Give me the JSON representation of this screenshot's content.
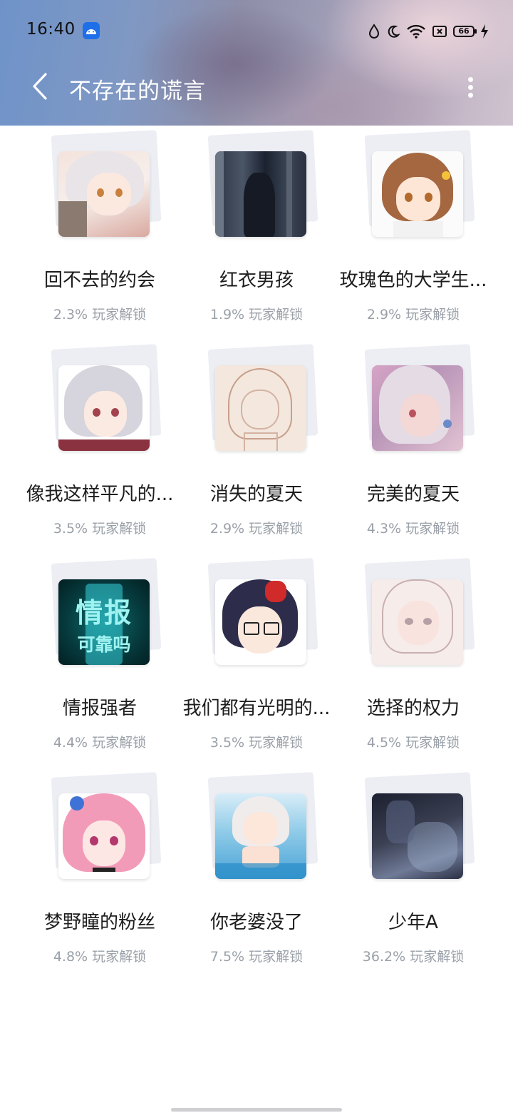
{
  "status_bar": {
    "time": "16:40",
    "battery": "66"
  },
  "header": {
    "title": "不存在的谎言"
  },
  "achievements": [
    {
      "title": "回不去的约会",
      "unlock": "2.3% 玩家解锁"
    },
    {
      "title": "红衣男孩",
      "unlock": "1.9% 玩家解锁"
    },
    {
      "title": "玫瑰色的大学生...",
      "unlock": "2.9% 玩家解锁"
    },
    {
      "title": "像我这样平凡的...",
      "unlock": "3.5% 玩家解锁"
    },
    {
      "title": "消失的夏天",
      "unlock": "2.9% 玩家解锁"
    },
    {
      "title": "完美的夏天",
      "unlock": "4.3% 玩家解锁"
    },
    {
      "title": "情报强者",
      "unlock": "4.4% 玩家解锁",
      "cover_text_1": "情报",
      "cover_text_2": "可靠吗"
    },
    {
      "title": "我们都有光明的...",
      "unlock": "3.5% 玩家解锁"
    },
    {
      "title": "选择的权力",
      "unlock": "4.5% 玩家解锁"
    },
    {
      "title": "梦野瞳的粉丝",
      "unlock": "4.8% 玩家解锁"
    },
    {
      "title": "你老婆没了",
      "unlock": "7.5% 玩家解锁"
    },
    {
      "title": "少年A",
      "unlock": "36.2% 玩家解锁"
    }
  ]
}
